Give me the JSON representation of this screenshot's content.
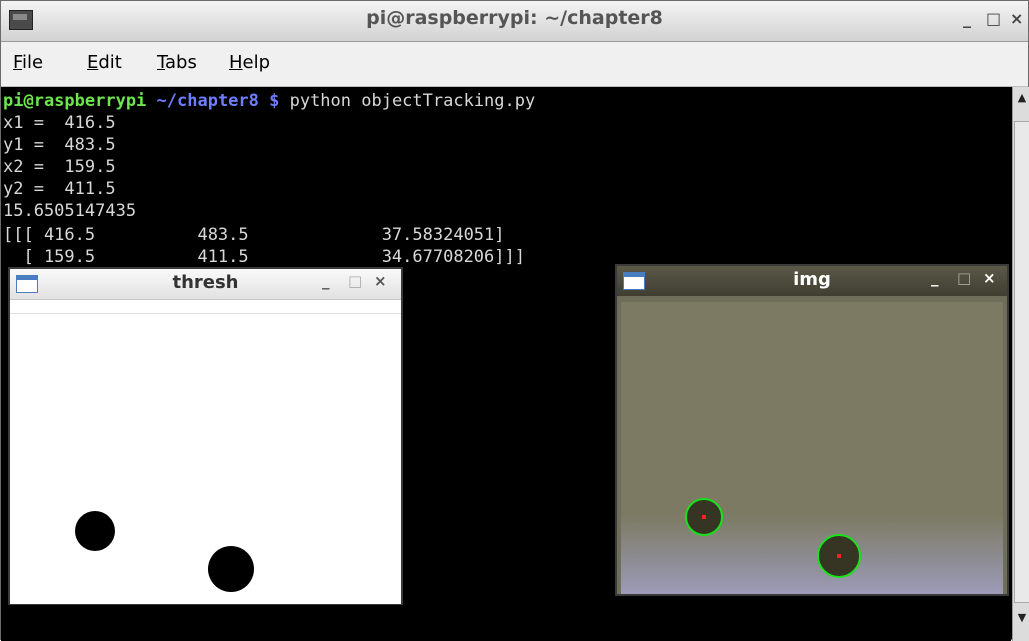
{
  "window": {
    "title": "pi@raspberrypi: ~/chapter8",
    "controls": [
      "_",
      "□",
      "×"
    ]
  },
  "menu": [
    {
      "mnemonic": "F",
      "rest": "ile"
    },
    {
      "mnemonic": "E",
      "rest": "dit"
    },
    {
      "mnemonic": "T",
      "rest": "abs"
    },
    {
      "mnemonic": "H",
      "rest": "elp"
    }
  ],
  "terminal": {
    "prompt_user": "pi@raspberrypi",
    "prompt_path": " ~/chapter8 $",
    "command": " python objectTracking.py",
    "lines": [
      "x1 =  416.5",
      "y1 =  483.5",
      "x2 =  159.5",
      "y2 =  411.5",
      "15.6505147435",
      "[[[ 416.5          483.5             37.58324051]",
      "  [ 159.5          411.5             34.67708206]]]"
    ]
  },
  "thresh_window": {
    "title": "thresh",
    "controls": [
      "_",
      "□",
      "×"
    ]
  },
  "img_window": {
    "title": "img",
    "controls": [
      "_",
      "□",
      "×"
    ]
  }
}
